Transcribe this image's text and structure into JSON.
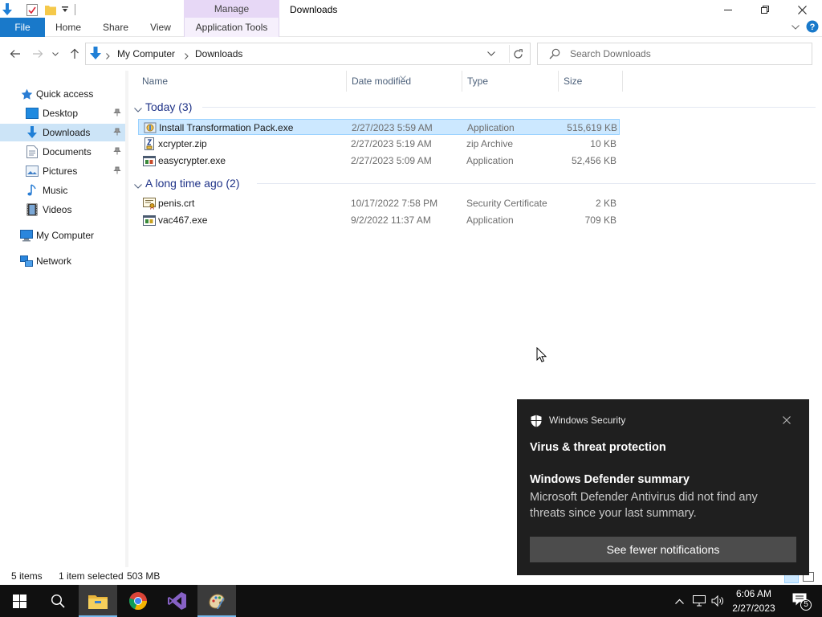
{
  "title_bar": {
    "context_tab_header": "Manage",
    "window_title": "Downloads"
  },
  "ribbon": {
    "tabs": [
      "File",
      "Home",
      "Share",
      "View",
      "Application Tools"
    ]
  },
  "address_bar": {
    "breadcrumbs": [
      "My Computer",
      "Downloads"
    ]
  },
  "search": {
    "placeholder": "Search Downloads"
  },
  "nav_pane": {
    "items": [
      {
        "label": "Quick access",
        "icon": "star-icon",
        "pinned": false
      },
      {
        "label": "Desktop",
        "icon": "desktop-icon",
        "pinned": true
      },
      {
        "label": "Downloads",
        "icon": "download-arrow-icon",
        "pinned": true
      },
      {
        "label": "Documents",
        "icon": "document-icon",
        "pinned": true
      },
      {
        "label": "Pictures",
        "icon": "picture-icon",
        "pinned": true
      },
      {
        "label": "Music",
        "icon": "music-note-icon",
        "pinned": false
      },
      {
        "label": "Videos",
        "icon": "film-icon",
        "pinned": false
      },
      {
        "label": "My Computer",
        "icon": "computer-icon",
        "pinned": false
      },
      {
        "label": "Network",
        "icon": "network-icon",
        "pinned": false
      }
    ]
  },
  "columns": [
    "Name",
    "Date modified",
    "Type",
    "Size"
  ],
  "groups": [
    {
      "title": "Today (3)",
      "files": [
        {
          "name": "Install Transformation Pack.exe",
          "date": "2/27/2023 5:59 AM",
          "type": "Application",
          "size": "515,619 KB",
          "icon": "installer-icon",
          "selected": true
        },
        {
          "name": "xcrypter.zip",
          "date": "2/27/2023 5:19 AM",
          "type": "zip Archive",
          "size": "10 KB",
          "icon": "zip-icon",
          "selected": false
        },
        {
          "name": "easycrypter.exe",
          "date": "2/27/2023 5:09 AM",
          "type": "Application",
          "size": "52,456 KB",
          "icon": "exe-icon",
          "selected": false
        }
      ]
    },
    {
      "title": "A long time ago (2)",
      "files": [
        {
          "name": "penis.crt",
          "date": "10/17/2022 7:58 PM",
          "type": "Security Certificate",
          "size": "2 KB",
          "icon": "certificate-icon",
          "selected": false
        },
        {
          "name": "vac467.exe",
          "date": "9/2/2022 11:37 AM",
          "type": "Application",
          "size": "709 KB",
          "icon": "exe-icon",
          "selected": false
        }
      ]
    }
  ],
  "status_bar": {
    "item_count": "5 items",
    "selection": "1 item selected",
    "selection_size": "503 MB"
  },
  "toast": {
    "app_name": "Windows Security",
    "heading": "Virus & threat protection",
    "subheading": "Windows Defender summary",
    "body": "Microsoft Defender Antivirus did not find any threats since your last summary.",
    "button_label": "See fewer notifications"
  },
  "taskbar": {
    "apps": [
      "start-icon",
      "search-icon",
      "file-explorer-icon",
      "chrome-icon",
      "visual-studio-icon",
      "paint-icon"
    ],
    "time": "6:06 AM",
    "date": "2/27/2023",
    "notification_count": "5"
  },
  "colors": {
    "accent": "#1979ca",
    "selection": "#cce8ff",
    "group_title": "#1e3287",
    "toast_bg": "#1f1f1f",
    "taskbar_bg": "#101010"
  }
}
